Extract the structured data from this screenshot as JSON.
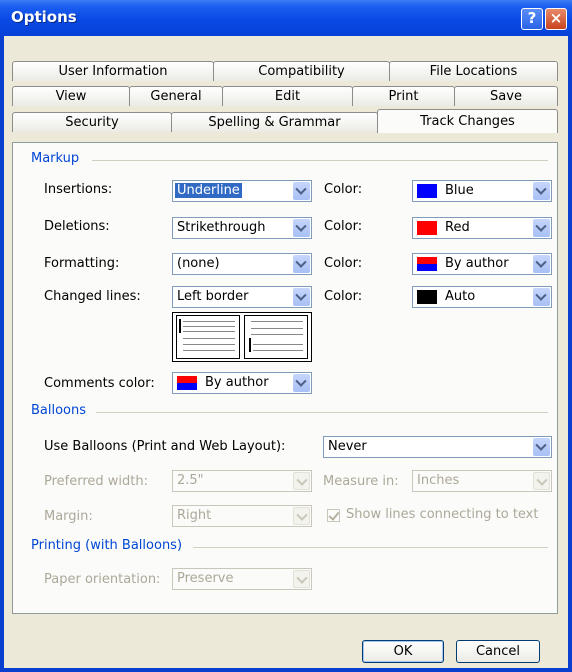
{
  "window": {
    "title": "Options",
    "help_glyph": "?",
    "close_glyph": "×"
  },
  "tabs": {
    "row1": [
      "User Information",
      "Compatibility",
      "File Locations"
    ],
    "row2": [
      "View",
      "General",
      "Edit",
      "Print",
      "Save"
    ],
    "row3": [
      "Security",
      "Spelling & Grammar",
      "Track Changes"
    ],
    "active": "Track Changes"
  },
  "markup": {
    "heading": "Markup",
    "insertions": {
      "label": "Insertions:",
      "value": "Underline",
      "color_label": "Color:",
      "color_value": "Blue"
    },
    "deletions": {
      "label": "Deletions:",
      "value": "Strikethrough",
      "color_label": "Color:",
      "color_value": "Red"
    },
    "formatting": {
      "label": "Formatting:",
      "value": "(none)",
      "color_label": "Color:",
      "color_value": "By author"
    },
    "changed_lines": {
      "label": "Changed lines:",
      "value": "Left border",
      "color_label": "Color:",
      "color_value": "Auto"
    },
    "comments_color": {
      "label": "Comments color:",
      "value": "By author"
    }
  },
  "balloons": {
    "heading": "Balloons",
    "use_balloons": {
      "label": "Use Balloons (Print and Web Layout):",
      "value": "Never"
    },
    "preferred_width": {
      "label": "Preferred width:",
      "value": "2.5\""
    },
    "measure_in": {
      "label": "Measure in:",
      "value": "Inches"
    },
    "margin": {
      "label": "Margin:",
      "value": "Right"
    },
    "show_lines": {
      "label": "Show lines connecting to text",
      "checked": true
    }
  },
  "printing": {
    "heading": "Printing (with Balloons)",
    "paper_orientation": {
      "label": "Paper orientation:",
      "value": "Preserve"
    }
  },
  "buttons": {
    "ok": "OK",
    "cancel": "Cancel"
  },
  "colors": {
    "blue": "#0000ff",
    "red": "#ff0000",
    "auto": "#000000",
    "accent": "#0046d5",
    "titlebar": "#0a49e4"
  }
}
